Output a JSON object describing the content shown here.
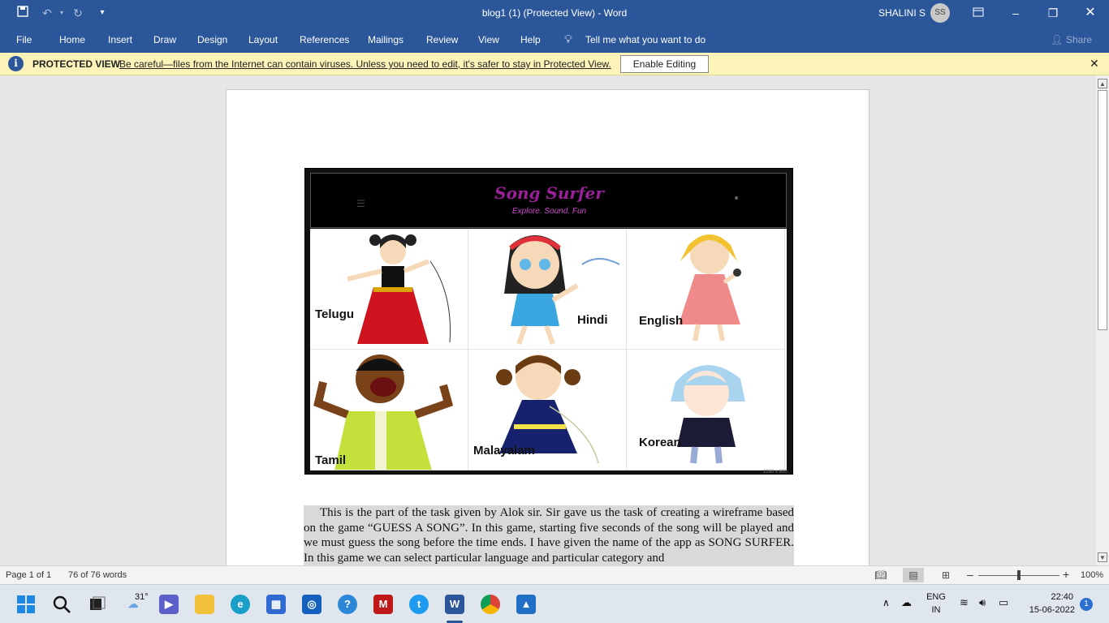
{
  "titlebar": {
    "title": "blog1 (1) (Protected View)  -  Word",
    "user": "SHALINI S",
    "avatar": "SS"
  },
  "ribbon": {
    "tabs": [
      "File",
      "Home",
      "Insert",
      "Draw",
      "Design",
      "Layout",
      "References",
      "Mailings",
      "Review",
      "View",
      "Help"
    ],
    "tell_me": "Tell me what you want to do",
    "share": "Share"
  },
  "protected_view": {
    "label": "PROTECTED VIEW",
    "message": "Be careful—files from the Internet can contain viruses. Unless you need to edit, it's safer to stay in Protected View.",
    "button": "Enable Editing"
  },
  "figure": {
    "app_title": "Song Surfer",
    "tagline": "Explore. Sound. Fun",
    "languages": [
      "Telugu",
      "Hindi",
      "English",
      "Tamil",
      "Malayalam",
      "Korean"
    ],
    "size_note": "1280 x 800"
  },
  "paragraph": "This is the part of the task given by Alok sir. Sir gave us the task of creating a wireframe based on the game “GUESS A SONG”. In this game, starting five seconds of the song will be played and we must guess the song before the time ends. I have given the name of the app as SONG SURFER. In this game we can select particular language and particular category and",
  "status": {
    "page": "Page 1 of 1",
    "words": "76 of 76 words",
    "zoom": "100%"
  },
  "taskbar": {
    "weather": "31°",
    "lang1": "ENG",
    "lang2": "IN",
    "time": "22:40",
    "date": "15-06-2022",
    "notif": "1"
  },
  "colors": {
    "word_blue": "#2b579a",
    "banner": "#fcf3b8",
    "app_title": "#9b1f9b"
  }
}
